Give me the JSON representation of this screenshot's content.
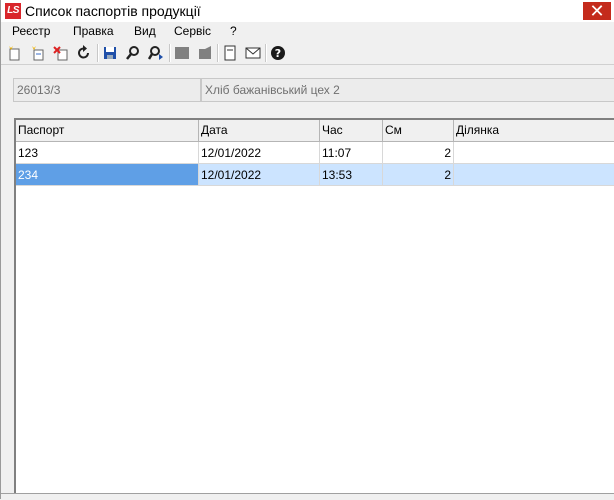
{
  "window": {
    "title": "Список паспортів продукції",
    "logo": "LS",
    "close": "✕"
  },
  "menu": [
    "Реєстр",
    "Правка",
    "Вид",
    "Сервіс",
    "?"
  ],
  "toolbar": {
    "icons": [
      "new-doc-icon",
      "copy-doc-icon",
      "delete-doc-icon",
      "refresh-icon",
      "save-icon",
      "search-icon",
      "find-next-icon",
      "gray-square-icon",
      "gray-edit-icon",
      "form-icon",
      "mail-icon",
      "help-icon"
    ]
  },
  "info": {
    "code": "26013/3",
    "name": "Хліб бажанівський цех 2"
  },
  "table": {
    "columns": [
      "Паспорт",
      "Дата",
      "Час",
      "См",
      "Ділянка"
    ],
    "rows": [
      {
        "passport": "123",
        "date": "12/01/2022",
        "time": "11:07",
        "shift": "2",
        "area": ""
      },
      {
        "passport": "234",
        "date": "12/01/2022",
        "time": "13:53",
        "shift": "2",
        "area": ""
      }
    ]
  }
}
